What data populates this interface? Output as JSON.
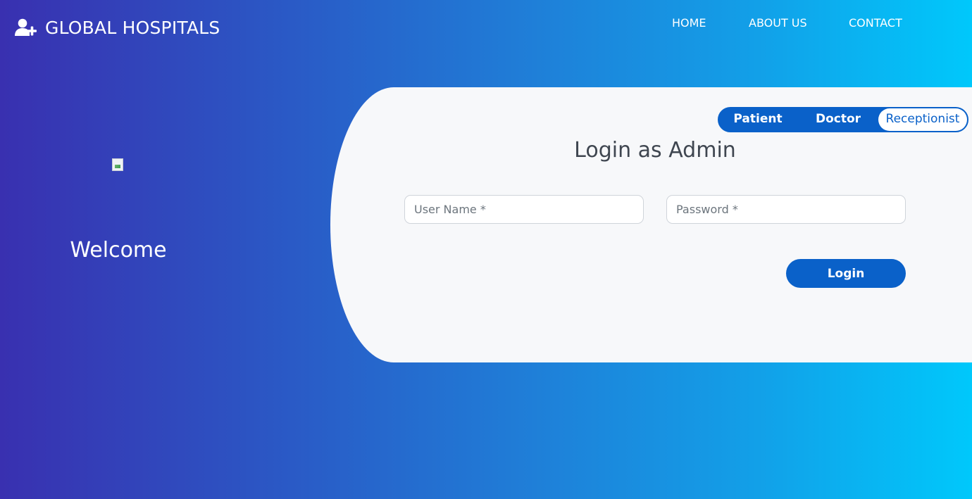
{
  "brand": {
    "title": "GLOBAL HOSPITALS",
    "icon": "user-plus-icon"
  },
  "nav": {
    "items": [
      {
        "label": "HOME"
      },
      {
        "label": "ABOUT US"
      },
      {
        "label": "CONTACT"
      }
    ]
  },
  "left": {
    "image_icon": "broken-image-icon",
    "welcome": "Welcome"
  },
  "login": {
    "roles": [
      {
        "label": "Patient",
        "active": false
      },
      {
        "label": "Doctor",
        "active": false
      },
      {
        "label": "Receptionist",
        "active": true
      }
    ],
    "title": "Login as Admin",
    "username_placeholder": "User Name *",
    "password_placeholder": "Password *",
    "submit_label": "Login"
  },
  "colors": {
    "gradient_start": "#3930b0",
    "gradient_end": "#00c8fb",
    "primary": "#0a61c9",
    "card_bg": "#f7f8fa"
  }
}
